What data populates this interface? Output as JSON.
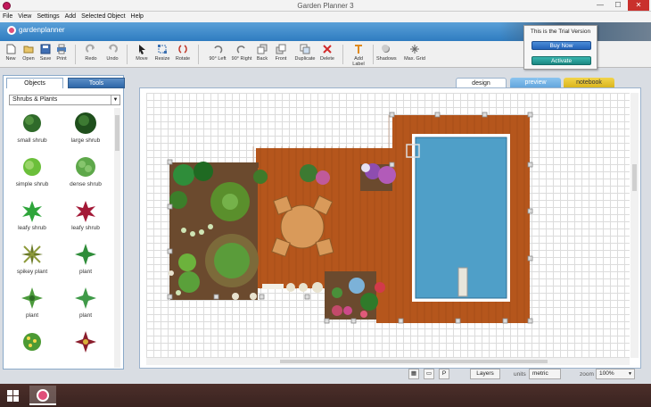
{
  "window": {
    "title": "Garden Planner 3",
    "minimize": "—",
    "maximize": "☐",
    "close": "✕"
  },
  "menu": [
    "File",
    "View",
    "Settings",
    "Add",
    "Selected Object",
    "Help"
  ],
  "banner": {
    "logo_text": "gardenplanner"
  },
  "toolbar": {
    "new": "New",
    "open": "Open",
    "save": "Save",
    "print": "Print",
    "redo": "Redo",
    "undo": "Undo",
    "move": "Move",
    "resize": "Resize",
    "rotate": "Rotate",
    "rot_left": "90° Left",
    "rot_right": "90° Right",
    "back": "Back",
    "front": "Front",
    "duplicate": "Duplicate",
    "delete": "Delete",
    "add_label": "Add Label",
    "shadows": "Shadows",
    "max_grid": "Max. Grid"
  },
  "trial": {
    "text": "This is the Trial Version",
    "buy": "Buy Now",
    "activate": "Activate"
  },
  "left_tabs": {
    "objects": "Objects",
    "tools": "Tools"
  },
  "category": "Shrubs & Plants",
  "objects": [
    {
      "label": "small shrub"
    },
    {
      "label": "large shrub"
    },
    {
      "label": "simple shrub"
    },
    {
      "label": "dense shrub"
    },
    {
      "label": "leafy shrub"
    },
    {
      "label": "leafy shrub"
    },
    {
      "label": "spikey plant"
    },
    {
      "label": "plant"
    },
    {
      "label": "plant"
    },
    {
      "label": "plant"
    },
    {
      "label": ""
    },
    {
      "label": ""
    }
  ],
  "view_tabs": {
    "design": "design",
    "preview": "preview",
    "notebook": "notebook"
  },
  "status": {
    "layers": "Layers",
    "units_label": "units",
    "units_value": "metric",
    "zoom_label": "zoom",
    "zoom_value": "100%"
  }
}
